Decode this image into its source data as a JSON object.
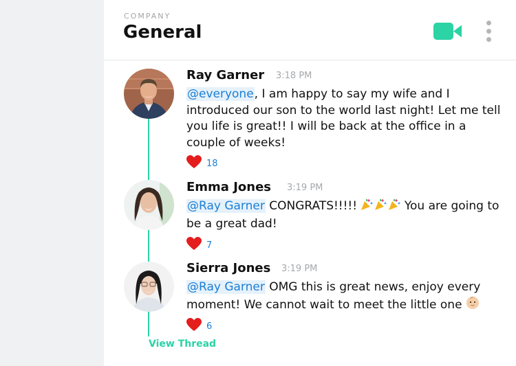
{
  "header": {
    "workspace": "COMPANY",
    "channel": "General",
    "video_icon": "video-camera-icon",
    "more_icon": "vertical-ellipsis-icon"
  },
  "colors": {
    "accent": "#2bd3a5",
    "mention": "#1b7fd6",
    "mention_bg": "#e5f1fb",
    "heart": "#e41d1d",
    "sidebar_bg": "#f0f1f3"
  },
  "messages": [
    {
      "author": "Ray Garner",
      "time": "3:18 PM",
      "mention": "@everyone",
      "text": ", I am happy to say my wife and I introduced our son to the world last night! Let me tell you life is great!! I will be back at the office in a couple of weeks!",
      "reaction_icon": "heart-icon",
      "reaction_count": "18"
    },
    {
      "author": "Emma Jones",
      "time": "3:19 PM",
      "mention": "@Ray Garner",
      "text_before": " CONGRATS!!!!! ",
      "emoji": "party-popper-icon",
      "text_after": " You are going to be a great dad!",
      "reaction_icon": "heart-icon",
      "reaction_count": "7"
    },
    {
      "author": "Sierra Jones",
      "time": "3:19 PM",
      "mention": "@Ray Garner",
      "text": " OMG this is great news, enjoy every moment! We cannot wait to meet the little one ",
      "emoji": "baby-face-icon",
      "reaction_icon": "heart-icon",
      "reaction_count": "6"
    }
  ],
  "thread": {
    "view_label": "View Thread"
  }
}
